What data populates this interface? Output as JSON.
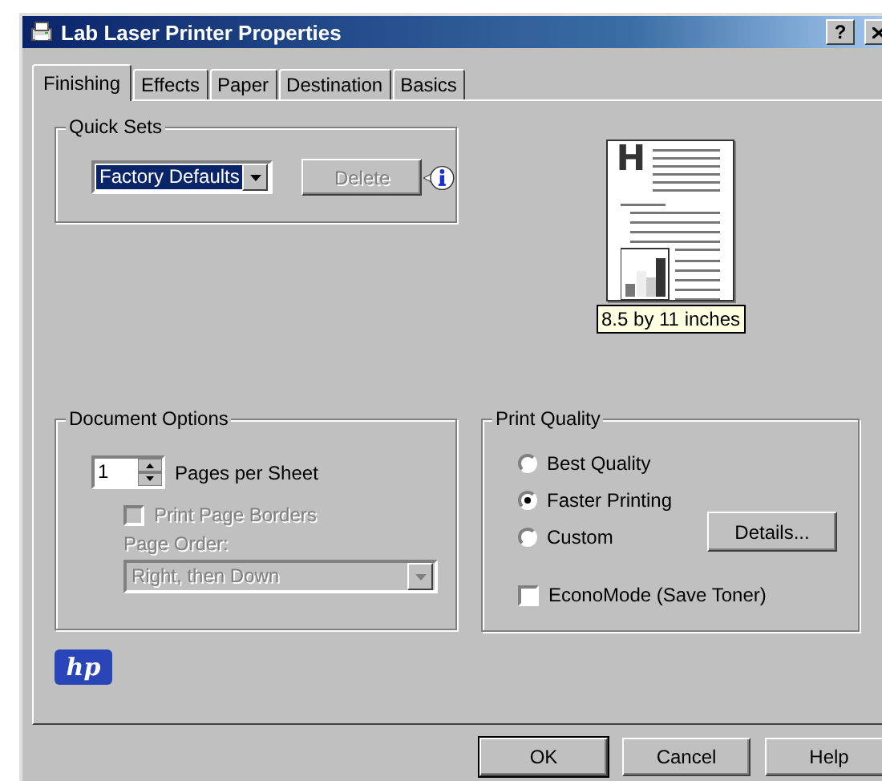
{
  "window": {
    "title": "Lab Laser Printer Properties",
    "help_button": "?"
  },
  "tabs": [
    {
      "label": "Finishing",
      "selected": true
    },
    {
      "label": "Effects",
      "selected": false
    },
    {
      "label": "Paper",
      "selected": false
    },
    {
      "label": "Destination",
      "selected": false
    },
    {
      "label": "Basics",
      "selected": false
    }
  ],
  "quick_sets": {
    "title": "Quick Sets",
    "dropdown": {
      "value": "Factory Defaults"
    },
    "delete_button": {
      "label": "Delete",
      "disabled": true
    }
  },
  "preview": {
    "heading_letter": "H",
    "size_label": "8.5 by 11 inches"
  },
  "document_options": {
    "title": "Document Options",
    "pages_per_sheet": {
      "value": "1",
      "label": "Pages per Sheet"
    },
    "print_page_borders": {
      "label": "Print Page Borders",
      "checked": false,
      "disabled": true
    },
    "page_order": {
      "label": "Page Order:",
      "value": "Right, then Down",
      "disabled": true
    }
  },
  "print_quality": {
    "title": "Print Quality",
    "options": [
      {
        "label": "Best Quality",
        "selected": false
      },
      {
        "label": "Faster Printing",
        "selected": true
      },
      {
        "label": "Custom",
        "selected": false
      }
    ],
    "details_button": "Details...",
    "econo_mode": {
      "label": "EconoMode (Save Toner)",
      "checked": false
    }
  },
  "logo": "hp",
  "buttons": [
    {
      "label": "OK",
      "default": true
    },
    {
      "label": "Cancel",
      "default": false
    },
    {
      "label": "Help",
      "default": false
    }
  ]
}
